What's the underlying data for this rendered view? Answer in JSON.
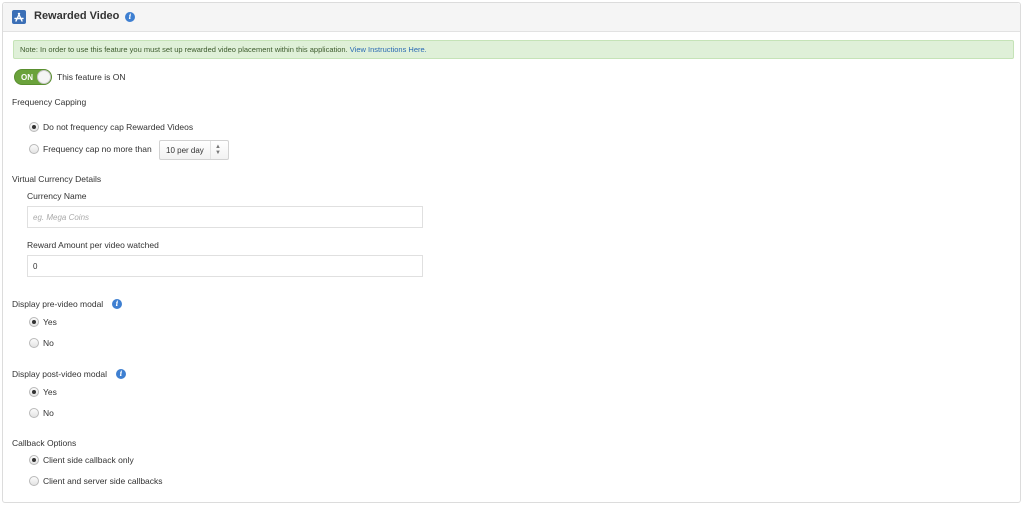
{
  "header": {
    "title": "Rewarded Video",
    "app_icon": "app-store-icon",
    "info_icon": "info-icon"
  },
  "note": {
    "text": "Note: In order to use this feature you must set up rewarded video placement within this application.",
    "link_text": "View Instructions Here."
  },
  "feature_toggle": {
    "label": "ON",
    "status_text": "This feature is ON",
    "state": "on"
  },
  "frequency_capping": {
    "title": "Frequency Capping",
    "options": [
      {
        "label": "Do not frequency cap Rewarded Videos",
        "checked": true
      },
      {
        "label": "Frequency cap no more than",
        "checked": false
      }
    ],
    "cap_select": {
      "value": "10 per day"
    }
  },
  "virtual_currency": {
    "title": "Virtual Currency Details",
    "currency_name": {
      "label": "Currency Name",
      "value": "",
      "placeholder": "eg. Mega Coins"
    },
    "reward_amount": {
      "label": "Reward Amount per video watched",
      "value": "0"
    }
  },
  "pre_video_modal": {
    "title": "Display pre-video modal",
    "options": [
      {
        "label": "Yes",
        "checked": true
      },
      {
        "label": "No",
        "checked": false
      }
    ]
  },
  "post_video_modal": {
    "title": "Display post-video modal",
    "options": [
      {
        "label": "Yes",
        "checked": true
      },
      {
        "label": "No",
        "checked": false
      }
    ]
  },
  "callback_options": {
    "title": "Callback Options",
    "options": [
      {
        "label": "Client side callback only",
        "checked": true
      },
      {
        "label": "Client and server side callbacks",
        "checked": false
      }
    ]
  },
  "colors": {
    "toggle_on": "#6aa23b",
    "note_bg": "#dff0d8",
    "link": "#2a6ab3",
    "info": "#3e7fd1"
  }
}
